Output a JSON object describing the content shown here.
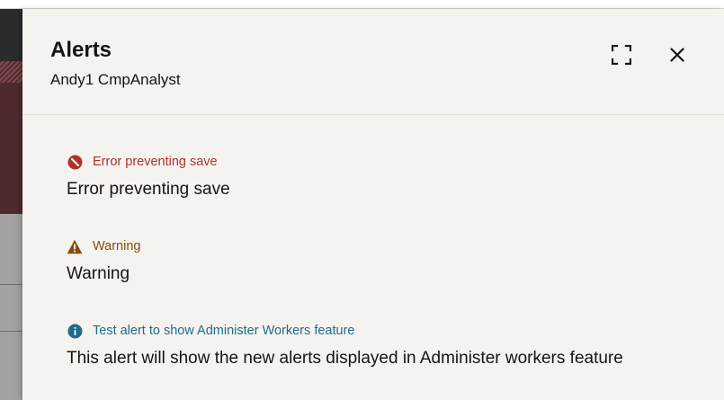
{
  "drawer": {
    "title": "Alerts",
    "subtitle": "Andy1 CmpAnalyst",
    "expand_icon": "expand-icon",
    "close_icon": "close-icon"
  },
  "alerts": [
    {
      "type": "error",
      "icon": "error-icon",
      "color": "#b3312a",
      "label": "Error preventing save",
      "message": "Error preventing save"
    },
    {
      "type": "warning",
      "icon": "warning-icon",
      "color": "#8a4a0f",
      "label": "Warning",
      "message": "Warning"
    },
    {
      "type": "info",
      "icon": "info-icon",
      "color": "#1f6c8a",
      "label": "Test alert to show Administer Workers feature",
      "message": "This alert will show the new alerts displayed in Administer workers feature"
    }
  ],
  "colors": {
    "drawer_background": "#f5f3f0",
    "text_primary": "#161513",
    "background_page_dark": "#4e2a2e",
    "background_page_gray": "#a3a3a1"
  }
}
